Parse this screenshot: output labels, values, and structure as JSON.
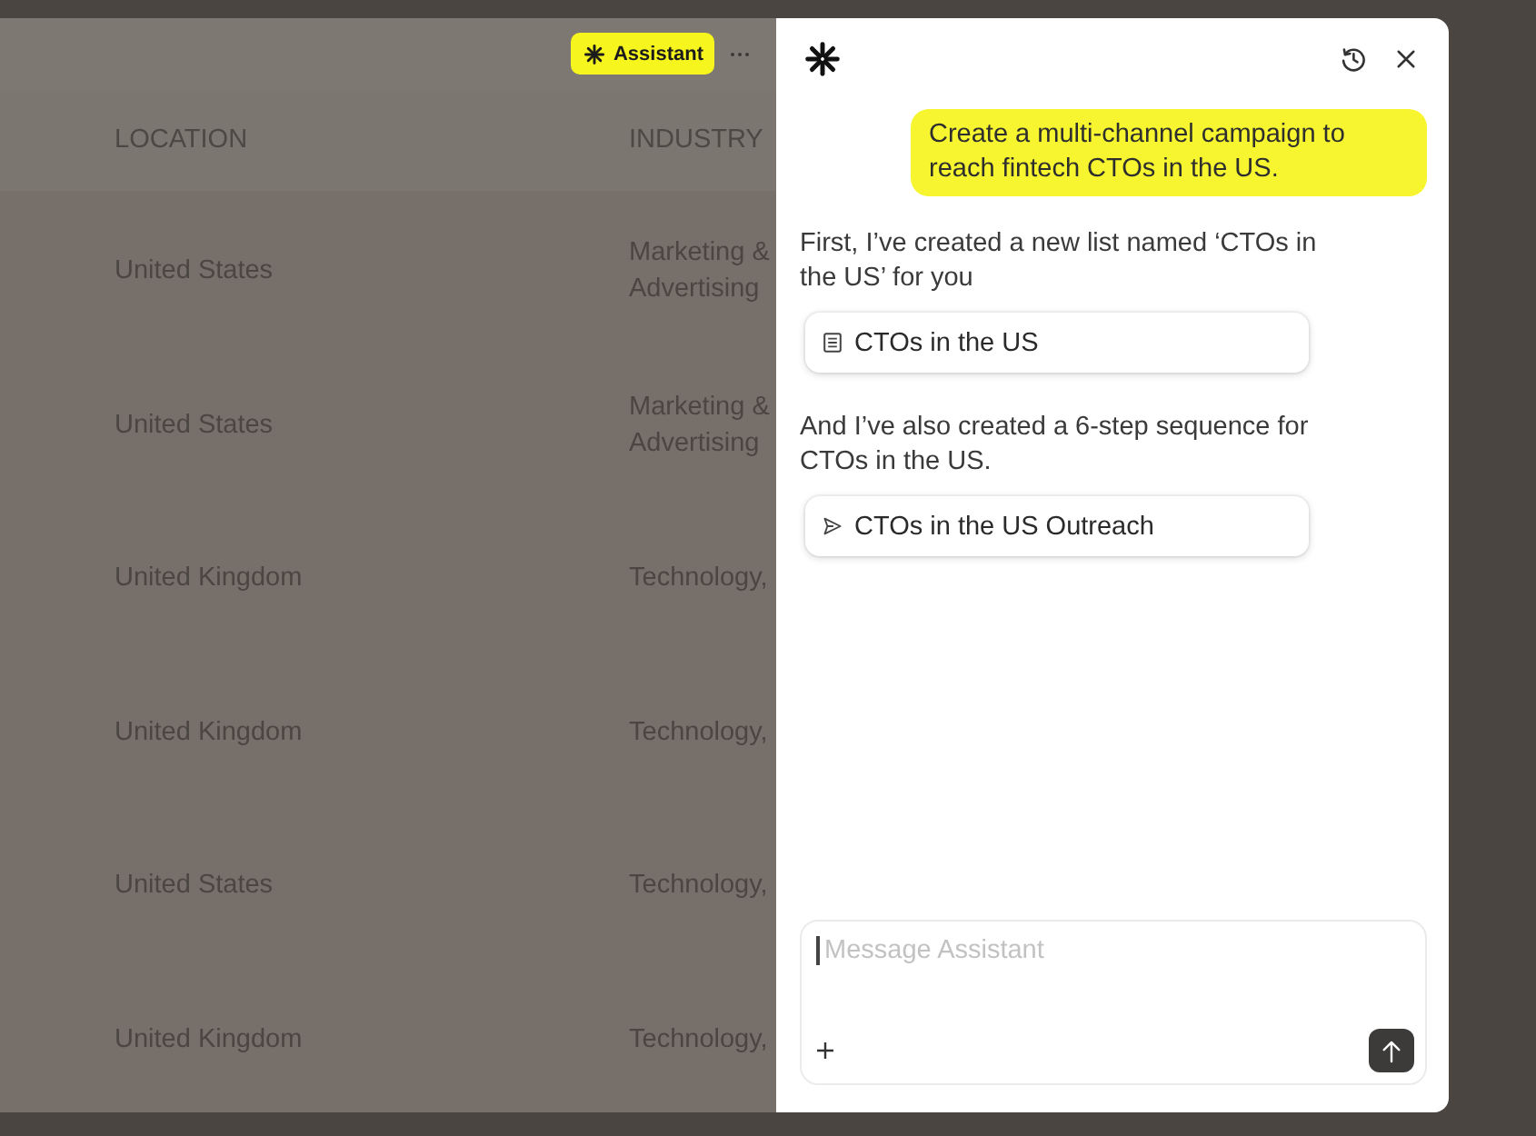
{
  "toolbar": {
    "assistant_button": "Assistant"
  },
  "table": {
    "columns": [
      "LOCATION",
      "INDUSTRY"
    ],
    "rows": [
      {
        "cells": [
          "United States",
          "Marketing & Advertising"
        ]
      },
      {
        "cells": [
          "United States",
          "Marketing & Advertising"
        ]
      },
      {
        "cells": [
          "United Kingdom",
          "Technology,"
        ]
      },
      {
        "cells": [
          "United Kingdom",
          "Technology,"
        ]
      },
      {
        "cells": [
          "United States",
          "Technology,"
        ]
      },
      {
        "cells": [
          "United Kingdom",
          "Technology,"
        ]
      }
    ]
  },
  "assistant_panel": {
    "messages": [
      {
        "kind": "user",
        "text": "Create a multi-channel campaign to reach fintech CTOs in the US."
      },
      {
        "kind": "assistant",
        "text": "First, I’ve created a new list named ‘CTOs in the US’ for you"
      },
      {
        "kind": "list",
        "text": "CTOs in the US"
      },
      {
        "kind": "assistant",
        "text": "And I’ve also created a 6-step sequence for CTOs in the US."
      },
      {
        "kind": "sequence",
        "text": "CTOs in the US Outreach"
      }
    ],
    "composer": {
      "placeholder": "Message Assistant",
      "focused": true
    }
  }
}
